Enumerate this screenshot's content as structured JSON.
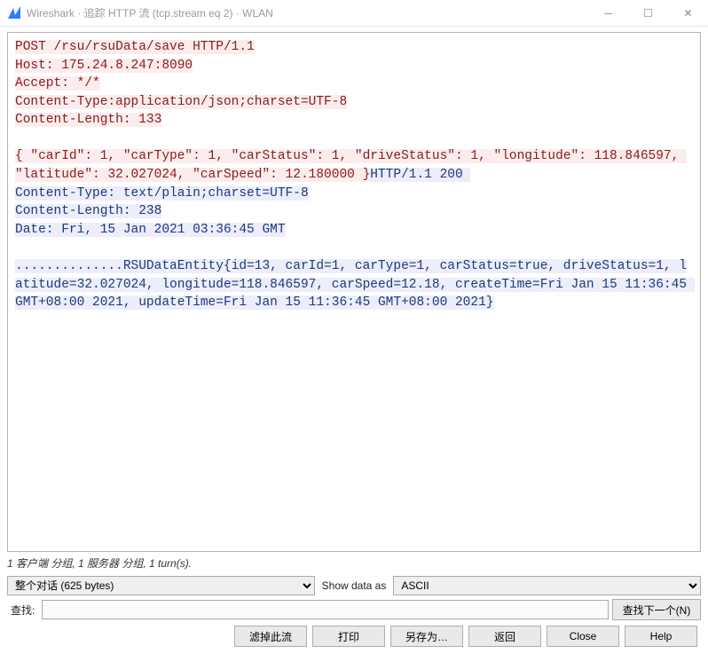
{
  "window": {
    "title": "Wireshark · 追踪 HTTP 流 (tcp.stream eq 2) · WLAN"
  },
  "stream": {
    "request": "POST /rsu/rsuData/save HTTP/1.1\nHost: 175.24.8.247:8090\nAccept: */*\nContent-Type:application/json;charset=UTF-8\nContent-Length: 133\n\n{ \"carId\": 1, \"carType\": 1, \"carStatus\": 1, \"driveStatus\": 1, \"longitude\": 118.846597, \"latitude\": 32.027024, \"carSpeed\": 12.180000 }",
    "response": "HTTP/1.1 200 \nContent-Type: text/plain;charset=UTF-8\nContent-Length: 238\nDate: Fri, 15 Jan 2021 03:36:45 GMT\n\n..............RSUDataEntity{id=13, carId=1, carType=1, carStatus=true, driveStatus=1, latitude=32.027024, longitude=118.846597, carSpeed=12.18, createTime=Fri Jan 15 11:36:45 GMT+08:00 2021, updateTime=Fri Jan 15 11:36:45 GMT+08:00 2021}"
  },
  "status": "1 客户端 分组, 1 服务器 分组, 1 turn(s).",
  "conversation": {
    "selector": "整个对话 (625 bytes)",
    "show_as_label": "Show data as",
    "encoding": "ASCII"
  },
  "find": {
    "label": "查找:",
    "value": "",
    "next": "查找下一个(N)"
  },
  "buttons": {
    "filter_out": "滤掉此流",
    "print": "打印",
    "save_as": "另存为…",
    "back": "返回",
    "close": "Close",
    "help": "Help"
  }
}
